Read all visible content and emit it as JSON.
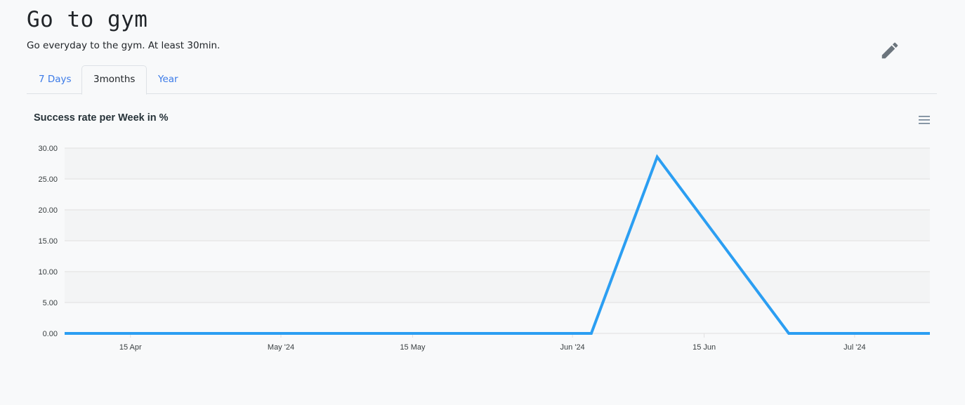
{
  "header": {
    "title": "Go to gym",
    "subtitle": "Go everyday to the gym. At least 30min."
  },
  "tabs": [
    {
      "label": "7 Days",
      "active": false
    },
    {
      "label": "3months",
      "active": true
    },
    {
      "label": "Year",
      "active": false
    }
  ],
  "icons": {
    "edit": "pencil-icon",
    "menu": "hamburger-menu-icon"
  },
  "colors": {
    "accent": "#3c7be8",
    "series": "#2b9ef2"
  },
  "chart_data": {
    "type": "line",
    "title": "Success rate per Week in %",
    "xlabel": "",
    "ylabel": "",
    "x_tick_labels": [
      "15 Apr",
      "May '24",
      "15 May",
      "Jun '24",
      "15 Jun",
      "Jul '24"
    ],
    "x_tick_dates": [
      "2024-04-15",
      "2024-05-01",
      "2024-05-15",
      "2024-06-01",
      "2024-06-15",
      "2024-07-01"
    ],
    "x_range": [
      "2024-04-08",
      "2024-07-09"
    ],
    "y_tick_labels": [
      "0.00",
      "5.00",
      "10.00",
      "15.00",
      "20.00",
      "25.00",
      "30.00"
    ],
    "ylim": [
      0,
      30
    ],
    "grid": true,
    "series": [
      {
        "x": [
          "2024-04-08",
          "2024-06-03",
          "2024-06-10",
          "2024-06-24",
          "2024-07-09"
        ],
        "y": [
          0,
          0,
          28.57,
          0,
          0
        ]
      }
    ]
  }
}
